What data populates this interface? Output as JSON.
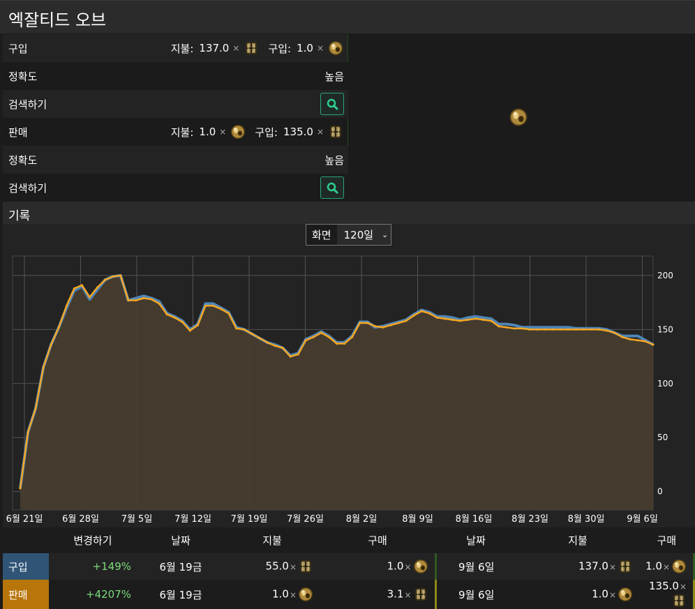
{
  "title": "엑잘티드 오브",
  "buy_panel": {
    "label": "구입",
    "pay_label": "지불:",
    "pay_value": "137.0",
    "times": "×",
    "get_label": "구입:",
    "get_value": "1.0",
    "accuracy_label": "정확도",
    "accuracy_value": "높음",
    "search_label": "검색하기"
  },
  "sell_panel": {
    "label": "판매",
    "pay_label": "지불:",
    "pay_value": "1.0",
    "times": "×",
    "get_label": "구입:",
    "get_value": "135.0",
    "accuracy_label": "정확도",
    "accuracy_value": "높음",
    "search_label": "검색하기"
  },
  "history": {
    "title": "기록",
    "view_label": "화면",
    "view_value": "120일"
  },
  "chart_data": {
    "type": "area",
    "x_ticks": [
      "6월 21일",
      "6월 28일",
      "7월 5일",
      "7월 12일",
      "7월 19일",
      "7월 26일",
      "8월 2일",
      "8월 9일",
      "8월 16일",
      "8월 23일",
      "8월 30일",
      "9월 6일"
    ],
    "y_ticks": [
      0,
      50,
      100,
      150,
      200
    ],
    "ylim": [
      -17,
      218
    ],
    "grid": true,
    "series": [
      {
        "name": "구입",
        "color": "#4f86b8",
        "values": [
          3,
          55,
          77,
          115,
          136,
          152,
          170,
          186,
          190,
          178,
          187,
          196,
          199,
          200,
          177,
          179,
          181,
          179,
          176,
          165,
          162,
          158,
          150,
          155,
          174,
          174,
          170,
          166,
          152,
          150,
          146,
          142,
          138,
          136,
          133,
          126,
          128,
          141,
          144,
          148,
          144,
          138,
          138,
          144,
          157,
          157,
          152,
          153,
          155,
          157,
          159,
          164,
          168,
          166,
          162,
          162,
          161,
          159,
          161,
          162,
          161,
          160,
          155,
          155,
          154,
          152,
          152,
          152,
          152,
          152,
          152,
          152,
          151,
          151,
          151,
          151,
          150,
          147,
          144,
          144,
          144,
          140,
          136
        ]
      },
      {
        "name": "판매",
        "color": "#f5a623",
        "values": [
          3,
          55,
          77,
          115,
          136,
          152,
          172,
          188,
          191,
          180,
          189,
          196,
          199,
          200,
          177,
          177,
          179,
          178,
          174,
          164,
          161,
          157,
          149,
          154,
          172,
          172,
          169,
          165,
          151,
          150,
          146,
          142,
          138,
          135,
          133,
          125,
          127,
          140,
          143,
          147,
          143,
          137,
          137,
          143,
          156,
          156,
          153,
          152,
          154,
          156,
          158,
          163,
          167,
          165,
          161,
          160,
          159,
          158,
          159,
          160,
          159,
          158,
          153,
          152,
          151,
          151,
          150,
          150,
          150,
          150,
          150,
          150,
          150,
          150,
          150,
          150,
          149,
          147,
          143,
          141,
          140,
          139,
          136
        ]
      }
    ]
  },
  "table": {
    "headers": [
      "변경하기",
      "날짜",
      "지불",
      "구매",
      "날짜",
      "지불",
      "구매"
    ],
    "rows": [
      {
        "label": "구입",
        "label_color": "#2f5476",
        "change": "+149%",
        "date1": "6월 19금",
        "pay1": "55.0",
        "buy1": "1.0",
        "date2": "9월 6일",
        "pay2": "137.0",
        "buy2": "1.0",
        "divider_color": "#2c5a20"
      },
      {
        "label": "판매",
        "label_color": "#b8750a",
        "change": "+4207%",
        "date1": "6월 19금",
        "pay1": "1.0",
        "buy1": "3.1",
        "date2": "9월 6일",
        "pay2": "1.0",
        "buy2": "135.0",
        "divider_color": "#8c8a14"
      }
    ]
  },
  "colors": {
    "accent_green": "#2aa57a",
    "change_positive": "#7bdb7b",
    "area_fill": "#473d2f"
  }
}
